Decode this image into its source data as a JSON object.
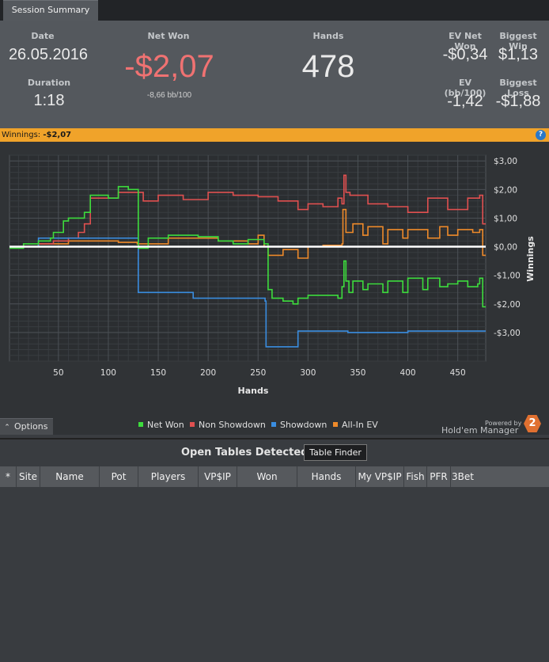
{
  "tab": {
    "label": "Session Summary"
  },
  "summary": {
    "date_label": "Date",
    "date_value": "26.05.2016",
    "duration_label": "Duration",
    "duration_value": "1:18",
    "netwon_label": "Net Won",
    "netwon_value": "-$2,07",
    "netwon_bb": "-8,66 bb/100",
    "hands_label": "Hands",
    "hands_value": "478",
    "ev_net_won_label": "EV Net Won",
    "ev_net_won_value": "-$0,34",
    "biggest_win_label": "Biggest Win",
    "biggest_win_value": "$1,13",
    "ev_bb_label": "EV (bb/100)",
    "ev_bb_value": "-1,42",
    "biggest_loss_label": "Biggest Loss",
    "biggest_loss_value": "-$1,88"
  },
  "winnings_bar": {
    "label": "Winnings:",
    "value": "-$2,07",
    "help_icon": "question-icon"
  },
  "colors": {
    "net_won": "#3ddc3d",
    "non_showdown": "#e05050",
    "showdown": "#3a8de0",
    "allin_ev": "#ee8a2a",
    "accent": "#f0a32a",
    "negative": "#f07272"
  },
  "chart_data": {
    "type": "line",
    "xlabel": "Hands",
    "ylabel": "Winnings",
    "xlim": [
      1,
      478
    ],
    "ylim": [
      -4,
      3.2
    ],
    "xticks": [
      "50",
      "100",
      "150",
      "200",
      "250",
      "300",
      "350",
      "400",
      "450"
    ],
    "yticks": [
      "$3,00",
      "$2,00",
      "$1,00",
      "$0,00",
      "-$1,00",
      "-$2,00",
      "-$3,00"
    ],
    "series": [
      {
        "name": "Net Won",
        "color": "#3ddc3d",
        "x": [
          1,
          15,
          30,
          42,
          45,
          55,
          60,
          70,
          76,
          82,
          90,
          100,
          110,
          120,
          129,
          130,
          140,
          160,
          190,
          210,
          225,
          240,
          250,
          256,
          260,
          264,
          275,
          285,
          290,
          300,
          315,
          330,
          334,
          336,
          338,
          341,
          345,
          355,
          360,
          375,
          380,
          395,
          400,
          415,
          420,
          432,
          440,
          450,
          460,
          470,
          472,
          475,
          478
        ],
        "y": [
          -0.05,
          0.1,
          0.2,
          0.3,
          0.5,
          0.9,
          1.0,
          1.0,
          1.2,
          1.8,
          1.8,
          1.7,
          2.1,
          2.0,
          2.0,
          -0.05,
          0.3,
          0.4,
          0.35,
          0.2,
          0.1,
          0.25,
          0.25,
          0.1,
          -1.5,
          -1.8,
          -1.9,
          -2.0,
          -1.8,
          -1.7,
          -1.7,
          -1.8,
          -1.4,
          -0.5,
          -1.2,
          -1.6,
          -1.2,
          -1.5,
          -1.3,
          -1.6,
          -1.2,
          -1.6,
          -1.1,
          -1.5,
          -1.1,
          -1.4,
          -1.3,
          -1.2,
          -1.4,
          -1.3,
          -1.1,
          -2.1,
          -2.1
        ]
      },
      {
        "name": "Non Showdown",
        "color": "#e05050",
        "x": [
          1,
          30,
          45,
          60,
          70,
          76,
          82,
          100,
          110,
          129,
          135,
          150,
          175,
          200,
          225,
          250,
          270,
          290,
          300,
          315,
          330,
          334,
          336,
          338,
          342,
          360,
          380,
          400,
          420,
          440,
          460,
          472,
          475,
          478
        ],
        "y": [
          0,
          0.1,
          0.2,
          0.3,
          0.5,
          0.8,
          1.7,
          1.7,
          1.9,
          1.9,
          1.6,
          1.8,
          1.65,
          1.9,
          1.8,
          1.75,
          1.6,
          1.3,
          1.5,
          1.4,
          1.7,
          1.5,
          2.5,
          1.9,
          1.8,
          1.5,
          1.4,
          1.2,
          1.7,
          1.3,
          1.7,
          1.8,
          0.8,
          0.8
        ]
      },
      {
        "name": "Showdown",
        "color": "#3a8de0",
        "x": [
          1,
          30,
          129,
          130,
          180,
          185,
          256,
          257,
          258,
          289,
          290,
          300,
          320,
          340,
          341,
          400,
          440,
          478
        ],
        "y": [
          0,
          0.3,
          0.3,
          -1.6,
          -1.6,
          -1.8,
          -1.8,
          -1.9,
          -3.5,
          -3.5,
          -2.95,
          -2.95,
          -2.95,
          -3.0,
          -3.0,
          -2.95,
          -2.95,
          -2.95
        ]
      },
      {
        "name": "All-In EV",
        "color": "#ee8a2a",
        "x": [
          1,
          30,
          60,
          82,
          110,
          129,
          140,
          160,
          190,
          210,
          240,
          250,
          256,
          260,
          275,
          290,
          300,
          315,
          334,
          335,
          338,
          345,
          355,
          360,
          375,
          380,
          395,
          400,
          420,
          432,
          440,
          450,
          465,
          472,
          475,
          478
        ],
        "y": [
          0,
          0.1,
          0.2,
          0.2,
          0.15,
          0.1,
          0.1,
          0.3,
          0.3,
          0.2,
          0.1,
          0.4,
          0.0,
          -0.3,
          -0.1,
          -0.4,
          0.0,
          0.05,
          0.1,
          1.3,
          0.5,
          0.8,
          0.4,
          0.7,
          0.1,
          0.6,
          0.3,
          0.6,
          0.3,
          0.7,
          0.4,
          0.6,
          0.5,
          0.6,
          -0.3,
          -0.3
        ]
      }
    ]
  },
  "options_button": {
    "label": "Options"
  },
  "legend": [
    "Net Won",
    "Non Showdown",
    "Showdown",
    "All-In EV"
  ],
  "branding": {
    "powered_by": "Powered by",
    "product": "Hold'em Manager",
    "logo_text": "2"
  },
  "open_tables": {
    "title": "Open Tables Detected",
    "button": "Table Finder",
    "columns": [
      "*",
      "Site",
      "Name",
      "Pot",
      "Players",
      "VP$IP",
      "Won",
      "Hands",
      "My VP$IP",
      "Fish",
      "PFR",
      "3Bet"
    ]
  }
}
